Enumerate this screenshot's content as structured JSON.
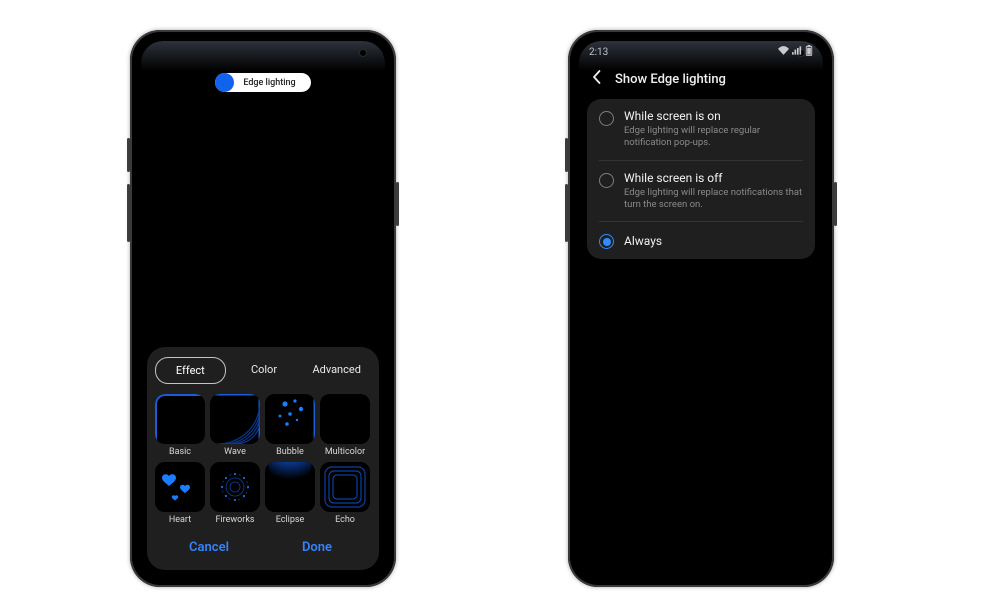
{
  "phone1": {
    "pill": {
      "label": "Edge lighting"
    },
    "tabs": {
      "effect": "Effect",
      "color": "Color",
      "advanced": "Advanced"
    },
    "effects": {
      "basic": "Basic",
      "wave": "Wave",
      "bubble": "Bubble",
      "multicolor": "Multicolor",
      "heart": "Heart",
      "fireworks": "Fireworks",
      "eclipse": "Eclipse",
      "echo": "Echo"
    },
    "actions": {
      "cancel": "Cancel",
      "done": "Done"
    }
  },
  "phone2": {
    "status": {
      "time": "2:13"
    },
    "header": {
      "title": "Show Edge lighting"
    },
    "options": {
      "on": {
        "title": "While screen is on",
        "desc": "Edge lighting will replace regular notification pop-ups."
      },
      "off": {
        "title": "While screen is off",
        "desc": "Edge lighting will replace notifications that turn the screen on."
      },
      "always": {
        "title": "Always"
      }
    }
  }
}
